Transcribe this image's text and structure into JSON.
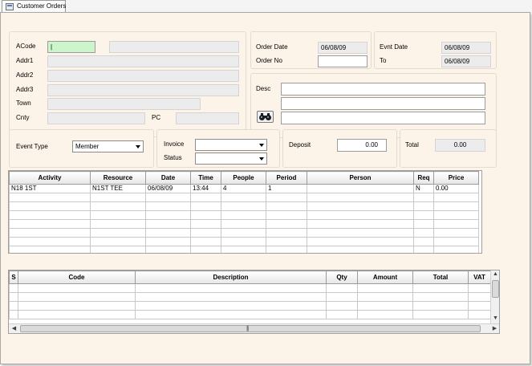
{
  "tab": {
    "title": "Customer Orders",
    "icon": "form-icon"
  },
  "customer": {
    "acode_label": "ACode",
    "acode_value": "|",
    "addr1_label": "Addr1",
    "addr2_label": "Addr2",
    "addr3_label": "Addr3",
    "town_label": "Town",
    "cnty_label": "Cnty",
    "pc_label": "PC"
  },
  "order": {
    "order_date_label": "Order Date",
    "order_date_value": "06/08/09",
    "order_no_label": "Order No"
  },
  "event": {
    "evnt_date_label": "Evnt Date",
    "evnt_date_value": "06/08/09",
    "to_label": "To",
    "to_value": "06/08/09"
  },
  "desc": {
    "label": "Desc",
    "button_icon": "binoculars-icon"
  },
  "event_type": {
    "label": "Event Type",
    "value": "Member"
  },
  "invoice": {
    "label": "Invoice",
    "value": ""
  },
  "status": {
    "label": "Status",
    "value": ""
  },
  "deposit": {
    "label": "Deposit",
    "value": "0.00"
  },
  "total": {
    "label": "Total",
    "value": "0.00"
  },
  "activity_grid": {
    "columns": [
      "Activity",
      "Resource",
      "Date",
      "Time",
      "People",
      "Period",
      "Person",
      "Req",
      "Price"
    ],
    "rows": [
      [
        "N18 1ST",
        "N1ST TEE",
        "06/08/09",
        "13:44",
        "4",
        "1",
        "",
        "N",
        "0.00"
      ]
    ]
  },
  "items_grid": {
    "columns": [
      "S",
      "Code",
      "Description",
      "Qty",
      "Amount",
      "Total",
      "VAT"
    ],
    "rows": []
  }
}
